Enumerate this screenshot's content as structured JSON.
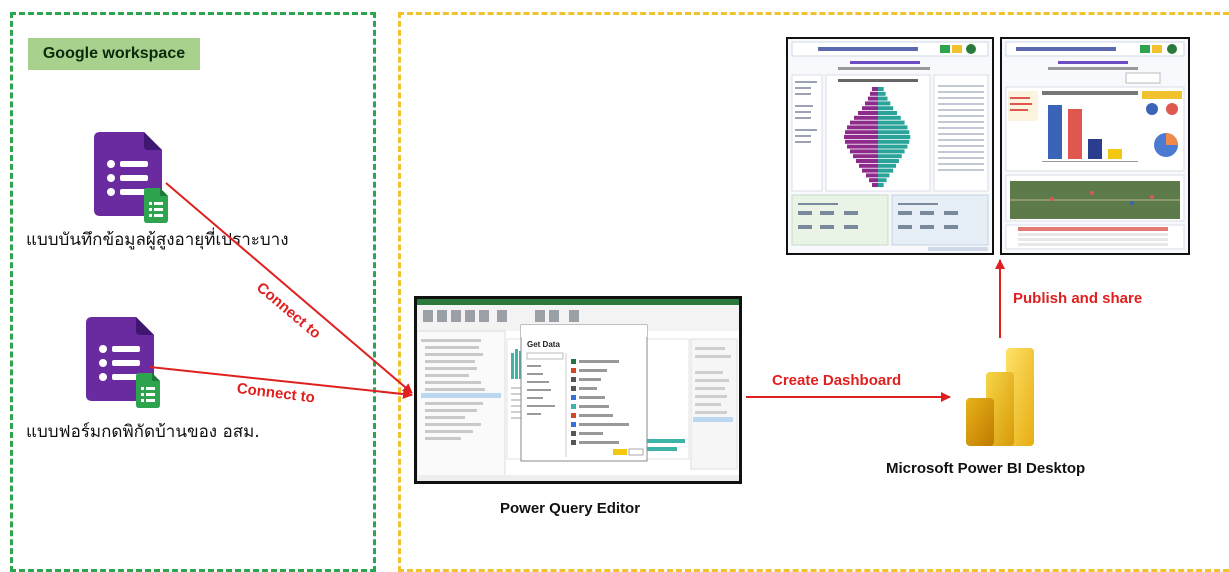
{
  "google_workspace": {
    "label": "Google workspace",
    "forms": [
      {
        "name": "แบบบันทึกข้อมูลผู้สูงอายุที่เปราะบาง",
        "icon": "google-forms-icon"
      },
      {
        "name": "แบบฟอร์มกดพิกัดบ้านของ อสม.",
        "icon": "google-forms-icon"
      }
    ]
  },
  "flow": {
    "connect_label_1": "Connect to",
    "connect_label_2": "Connect to",
    "create_dashboard_label": "Create Dashboard",
    "publish_label": "Publish and share"
  },
  "power_query": {
    "caption": "Power Query Editor",
    "dialog_title": "Get Data"
  },
  "power_bi": {
    "caption": "Microsoft Power BI Desktop",
    "icon": "power-bi-icon"
  },
  "colors": {
    "green_dashed": "#2ea44f",
    "yellow_dashed": "#f2c12e",
    "label_fill": "#a9d18e",
    "arrow_red": "#e02020",
    "forms_purple": "#6a2ba0",
    "powerbi_yellow": "#f2c811"
  }
}
